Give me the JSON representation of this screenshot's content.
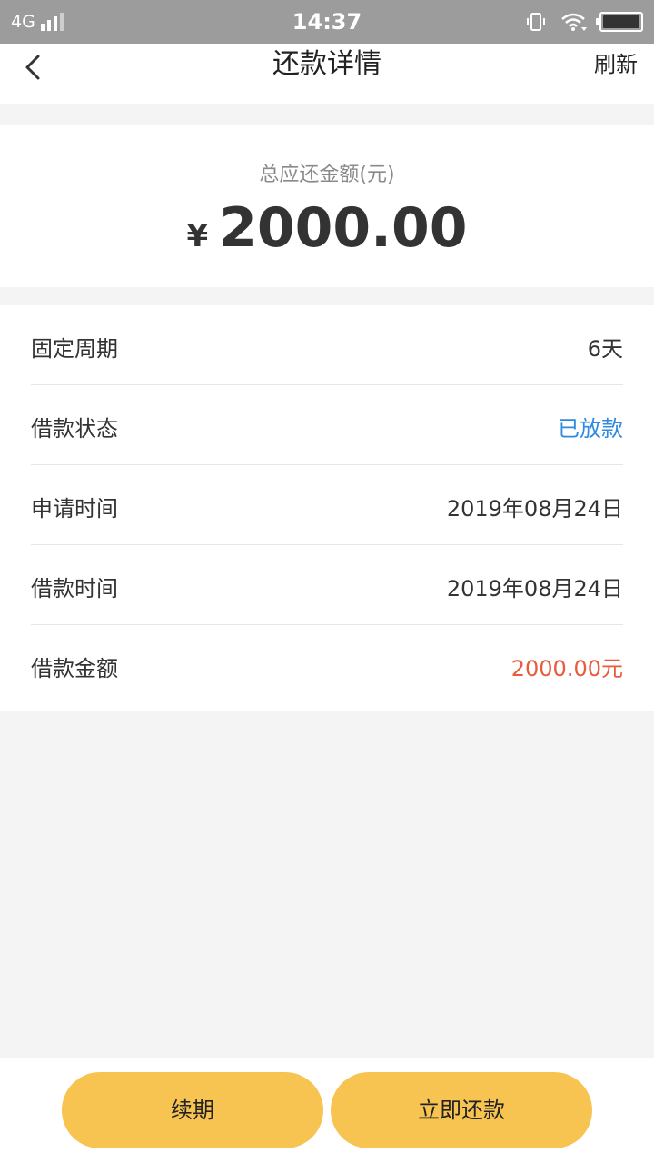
{
  "status_bar": {
    "network": "4G",
    "time": "14:37"
  },
  "nav": {
    "title": "还款详情",
    "refresh_label": "刷新"
  },
  "summary": {
    "label": "总应还金额(元)",
    "currency": "¥",
    "amount": "2000.00"
  },
  "details": [
    {
      "label": "固定周期",
      "value": "6天"
    },
    {
      "label": "借款状态",
      "value": "已放款"
    },
    {
      "label": "申请时间",
      "value": "2019年08月24日"
    },
    {
      "label": "借款时间",
      "value": "2019年08月24日"
    },
    {
      "label": "借款金额",
      "value": "2000.00元"
    }
  ],
  "actions": {
    "renew_label": "续期",
    "repay_label": "立即还款"
  },
  "colors": {
    "accent_button": "#f7c452",
    "status_blue": "#2f8ae0",
    "amount_red": "#ea5a3c",
    "status_bar": "#9c9c9c"
  },
  "icons": [
    "signal-icon",
    "vibrate-icon",
    "wifi-icon",
    "battery-icon",
    "back-icon"
  ]
}
